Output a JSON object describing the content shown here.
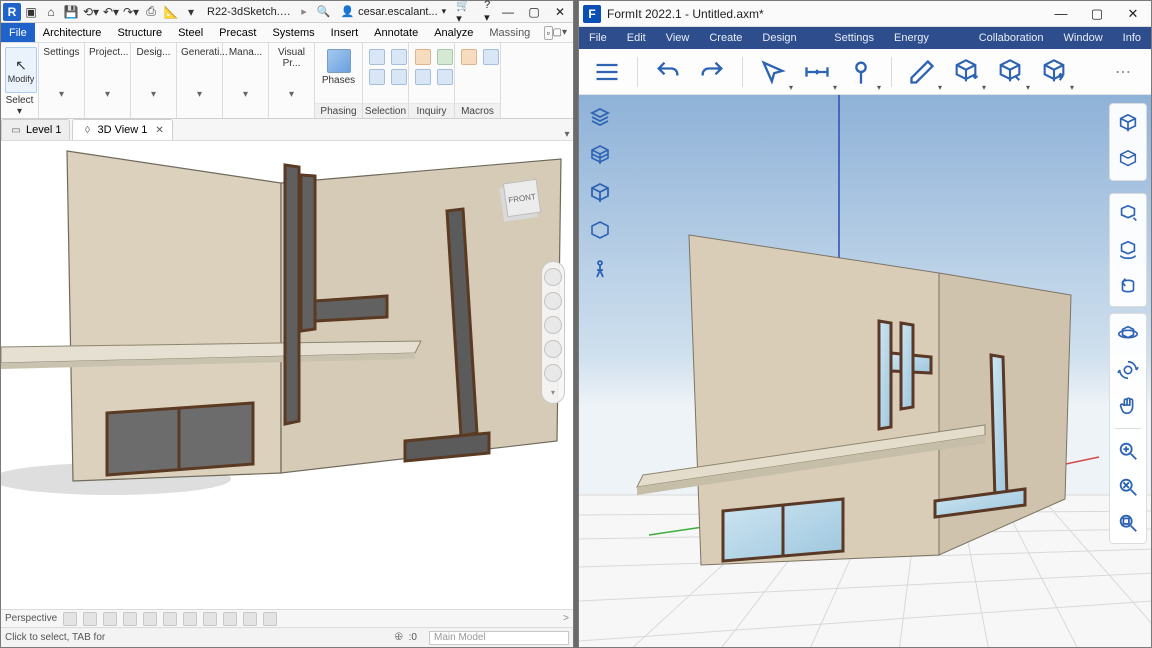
{
  "revit": {
    "title_file": "R22-3dSketch.rv...",
    "user": "cesar.escalant...",
    "qat_help": "?",
    "menubar": [
      "File",
      "Architecture",
      "Structure",
      "Steel",
      "Precast",
      "Systems",
      "Insert",
      "Annotate",
      "Analyze",
      "Massing & Site"
    ],
    "ribbon": {
      "modify": "Modify",
      "select_label": "Select",
      "settings": "Settings",
      "project": "Project...",
      "design": "Desig...",
      "generate": "Generati...",
      "manage": "Mana...",
      "visual": "Visual Pr...",
      "phases": "Phases",
      "phasing": "Phasing",
      "selection": "Selection",
      "inquiry": "Inquiry",
      "macros": "Macros"
    },
    "tabs": {
      "level1": "Level 1",
      "view3d": "3D View 1"
    },
    "viewcube_face": "FRONT",
    "perspective": "Perspective",
    "status": "Click to select, TAB for a",
    "zoom": ":0",
    "main_model": "Main Model"
  },
  "formit": {
    "title": "FormIt 2022.1 - Untitled.axm*",
    "menubar": [
      "File",
      "Edit",
      "View",
      "Create",
      "Design Tools",
      "Settings",
      "Energy Analysis",
      "Collaboration",
      "Window",
      "Info"
    ]
  }
}
